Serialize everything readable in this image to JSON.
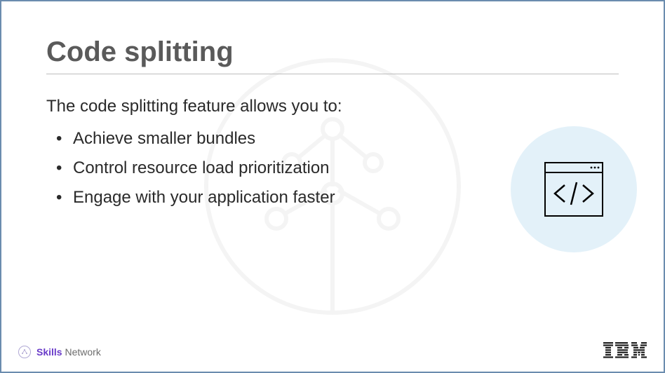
{
  "title": "Code splitting",
  "lead": "The code splitting feature allows you to:",
  "bullets": [
    "Achieve smaller bundles",
    "Control resource load prioritization",
    "Engage with your application faster"
  ],
  "footer": {
    "skills_bold": "Skills",
    "skills_rest": "Network",
    "brand": "IBM"
  }
}
